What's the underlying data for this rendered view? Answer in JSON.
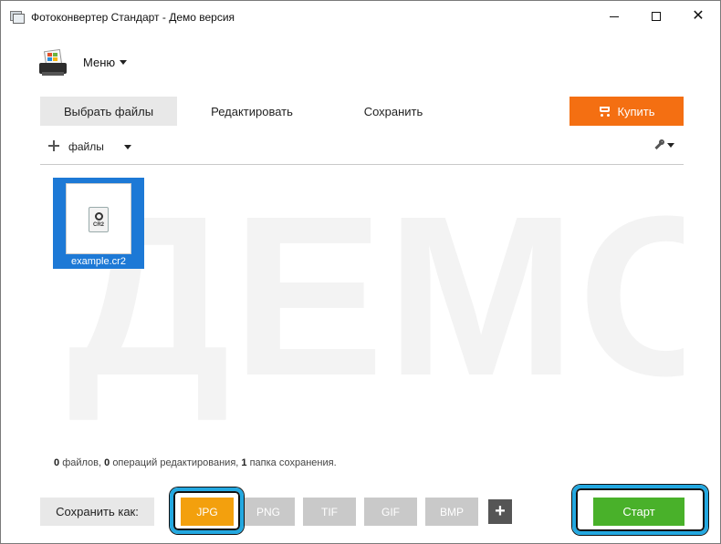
{
  "window": {
    "title": "Фотоконвертер Стандарт - Демо версия",
    "minimize_glyph": "",
    "maximize_glyph": "",
    "close_glyph": "✕"
  },
  "menu": {
    "label": "Меню"
  },
  "tabs": [
    {
      "label": "Выбрать файлы",
      "active": true
    },
    {
      "label": "Редактировать",
      "active": false
    },
    {
      "label": "Сохранить",
      "active": false
    }
  ],
  "buy": {
    "label": "Купить",
    "icon": "cart-icon",
    "color": "#f46f12"
  },
  "files_toolbar": {
    "add_label": "файлы",
    "settings_icon": "wrench-icon"
  },
  "workspace": {
    "watermark": "ДЕМО",
    "files": [
      {
        "name": "example.cr2",
        "ext": "CR2",
        "selected": true
      }
    ]
  },
  "status": {
    "files_count": "0",
    "files_label": "файлов,",
    "edit_count": "0",
    "edit_label": "операций редактирования,",
    "save_count": "1",
    "save_label": "папка сохранения."
  },
  "save_as": {
    "label": "Сохранить как:",
    "formats": [
      {
        "label": "JPG",
        "selected": true,
        "color": "#f3a00d"
      },
      {
        "label": "PNG",
        "selected": false
      },
      {
        "label": "TIF",
        "selected": false
      },
      {
        "label": "GIF",
        "selected": false
      },
      {
        "label": "BMP",
        "selected": false
      }
    ],
    "add_label": "+"
  },
  "start": {
    "label": "Старт",
    "color": "#49b12a"
  },
  "highlight_color": "#23a8e0"
}
